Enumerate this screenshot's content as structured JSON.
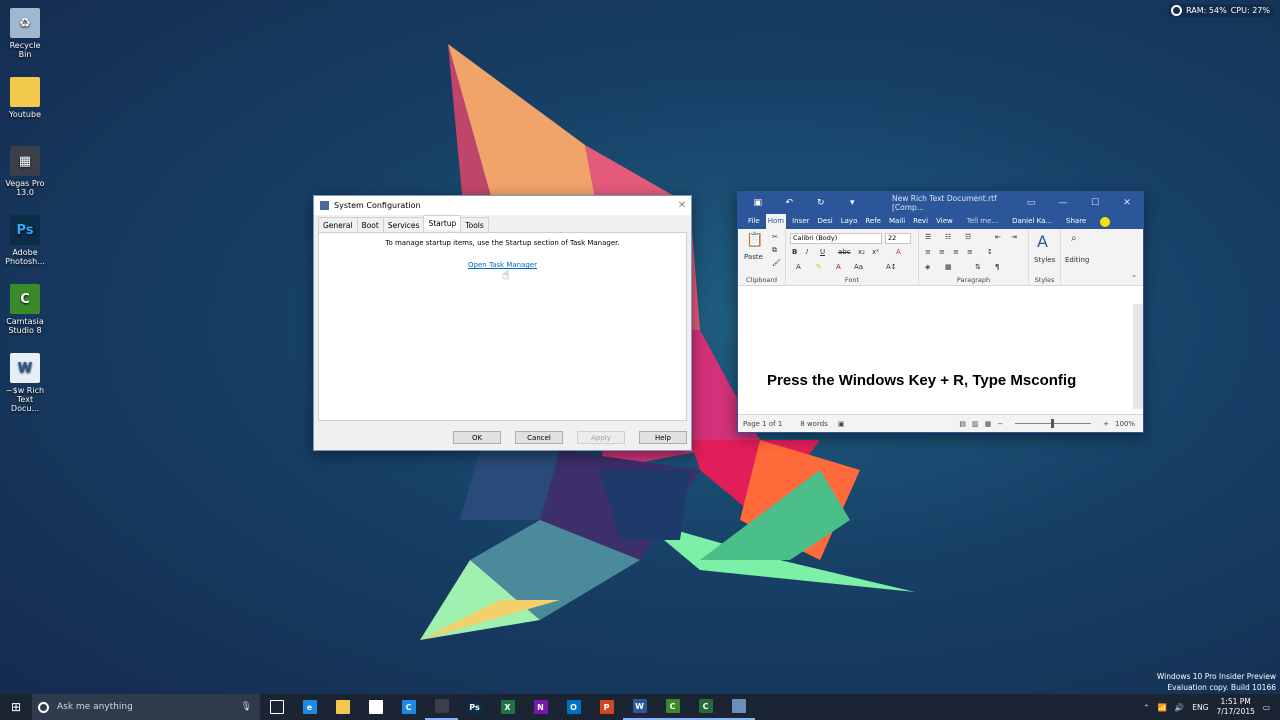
{
  "desktop": {
    "icons": [
      {
        "label": "Recycle Bin",
        "icon": "recycle-bin-icon",
        "color": "#9fb8d0"
      },
      {
        "label": "Youtube",
        "icon": "folder-icon",
        "color": "#f2c94c"
      },
      {
        "label": "Vegas Pro 13.0",
        "icon": "vegas-icon",
        "color": "#3a3f4a"
      },
      {
        "label": "Adobe Photosh...",
        "icon": "photoshop-icon",
        "color": "#0c2d48"
      },
      {
        "label": "Camtasia Studio 8",
        "icon": "camtasia-icon",
        "color": "#3a8a2a"
      },
      {
        "label": "~$w Rich Text Docu...",
        "icon": "word-doc-icon",
        "color": "#2b579a"
      }
    ],
    "monitor": {
      "ram": "RAM: 54%",
      "cpu": "CPU: 27%"
    },
    "watermark": {
      "line1": "Windows 10 Pro Insider Preview",
      "line2": "Evaluation copy. Build 10166"
    }
  },
  "msconfig": {
    "title": "System Configuration",
    "tabs": [
      "General",
      "Boot",
      "Services",
      "Startup",
      "Tools"
    ],
    "active_tab": "Startup",
    "message": "To manage startup items, use the Startup section of Task Manager.",
    "link": "Open Task Manager",
    "buttons": {
      "ok": "OK",
      "cancel": "Cancel",
      "apply": "Apply",
      "help": "Help"
    }
  },
  "word": {
    "doc_title": "New Rich Text Document.rtf [Comp...",
    "tabs": {
      "file": "File",
      "home": "Hom",
      "insert": "Inser",
      "design": "Desi",
      "layout": "Layo",
      "references": "Refe",
      "mailings": "Maili",
      "review": "Revi",
      "view": "View"
    },
    "tell_me": "Tell me...",
    "user": "Daniel Ka...",
    "share": "Share",
    "font_name": "Calibri (Body)",
    "font_size": "22",
    "groups": {
      "clipboard": "Clipboard",
      "font": "Font",
      "paragraph": "Paragraph",
      "styles": "Styles",
      "editing": "Editing"
    },
    "paste": "Paste",
    "styles_btn": "Styles",
    "editing_btn": "Editing",
    "body_text": "Press the Windows Key + R, Type Msconfig",
    "status": {
      "page": "Page 1 of 1",
      "words": "8 words",
      "zoom": "100%"
    }
  },
  "taskbar": {
    "search_placeholder": "Ask me anything",
    "apps": [
      {
        "name": "task-view",
        "label": "",
        "color": "#1b2433"
      },
      {
        "name": "edge",
        "label": "e",
        "color": "#1e88e5"
      },
      {
        "name": "file-explorer",
        "label": "",
        "color": "#f2c94c"
      },
      {
        "name": "store",
        "label": "",
        "color": "#ffffff"
      },
      {
        "name": "camtasia-recorder",
        "label": "C",
        "color": "#1e88e5"
      },
      {
        "name": "vegas",
        "label": "",
        "color": "#3a3f4a"
      },
      {
        "name": "photoshop",
        "label": "Ps",
        "color": "#0c2d48"
      },
      {
        "name": "excel",
        "label": "X",
        "color": "#217346"
      },
      {
        "name": "onenote",
        "label": "N",
        "color": "#7719aa"
      },
      {
        "name": "outlook",
        "label": "O",
        "color": "#0072c6"
      },
      {
        "name": "powerpoint",
        "label": "P",
        "color": "#d24726"
      },
      {
        "name": "word",
        "label": "W",
        "color": "#2b579a"
      },
      {
        "name": "camtasia",
        "label": "C",
        "color": "#3a8a2a"
      },
      {
        "name": "camtasia-2",
        "label": "C",
        "color": "#2a6a3a"
      },
      {
        "name": "msconfig",
        "label": "",
        "color": "#6c8ebf"
      }
    ],
    "language": "ENG",
    "time": "1:51 PM",
    "date": "7/17/2015"
  }
}
